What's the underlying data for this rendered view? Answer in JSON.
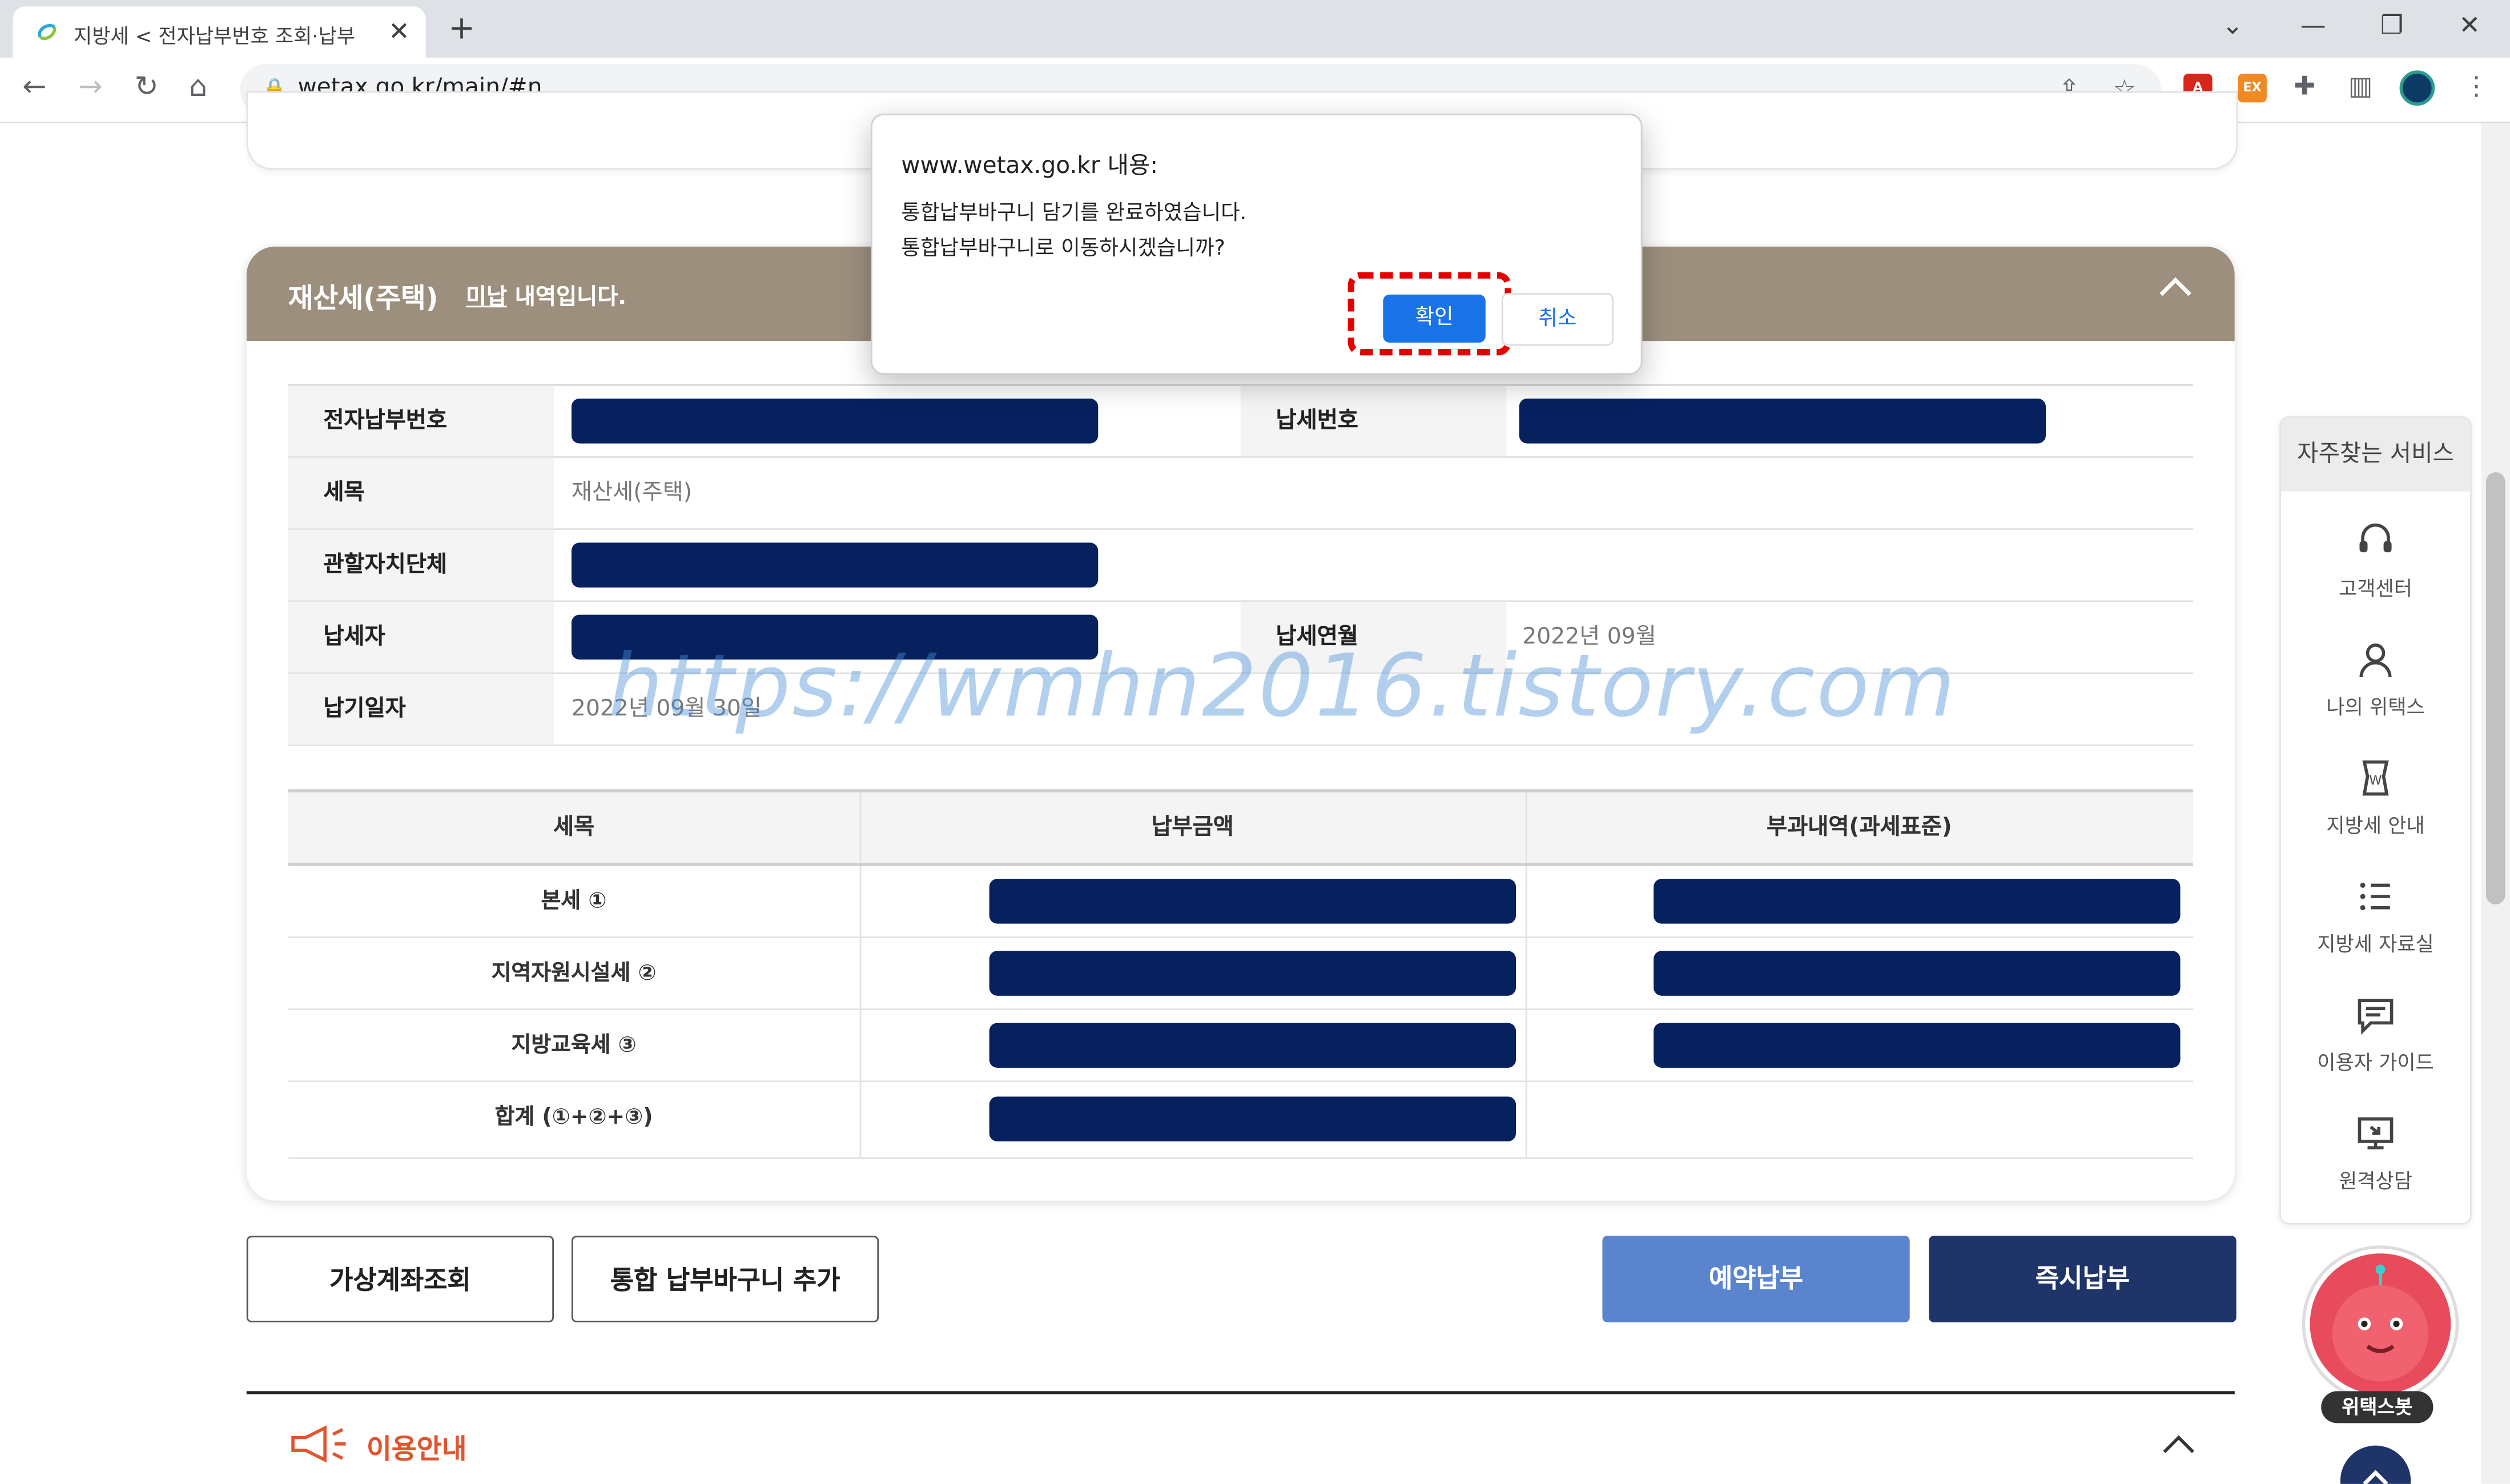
{
  "browser": {
    "tab_title": "지방세 < 전자납부번호 조회·납부",
    "url": "wetax.go.kr/main/#n",
    "ext_label": "EX"
  },
  "card": {
    "title": "재산세(주택)",
    "subtitle_prefix": "미납",
    "subtitle_suffix": " 내역입니다."
  },
  "info": {
    "label_epay": "전자납부번호",
    "label_taxno": "납세번호",
    "label_item": "세목",
    "value_item": "재산세(주택)",
    "label_region": "관할자치단체",
    "label_payer": "납세자",
    "label_ym": "납세연월",
    "value_ym": "2022년 09월",
    "label_due": "납기일자",
    "value_due": "2022년 09월 30일"
  },
  "amounts": {
    "headers": [
      "세목",
      "납부금액",
      "부과내역(과세표준)"
    ],
    "rows": [
      "본세 ①",
      "지역자원시설세 ②",
      "지방교육세 ③",
      "합계 (①+②+③)"
    ]
  },
  "buttons": {
    "virtual": "가상계좌조회",
    "basket": "통합 납부바구니 추가",
    "reserve": "예약납부",
    "instant": "즉시납부"
  },
  "guide": {
    "title": "이용안내"
  },
  "watermark": "https://wmhn2016.tistory.com",
  "quick": {
    "title": "자주찾는 서비스",
    "items": [
      "고객센터",
      "나의 위택스",
      "지방세 안내",
      "지방세 자료실",
      "이용자 가이드",
      "원격상담"
    ]
  },
  "bot_label": "위택스봇",
  "dialog": {
    "title": "www.wetax.go.kr 내용:",
    "line1": "통합납부바구니 담기를 완료하였습니다.",
    "line2": "통합납부바구니로 이동하시겠습니까?",
    "ok": "확인",
    "cancel": "취소"
  }
}
